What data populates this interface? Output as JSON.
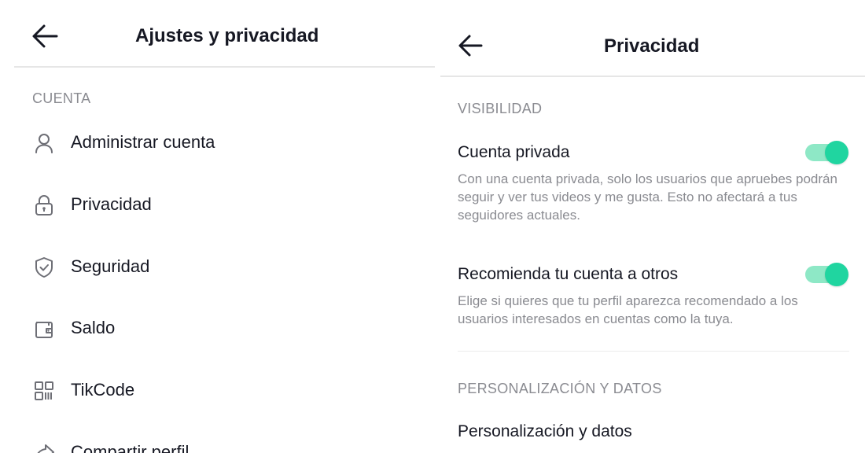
{
  "left_screen": {
    "title": "Ajustes y privacidad",
    "section_cuenta": "CUENTA",
    "items": [
      {
        "label": "Administrar cuenta",
        "icon": "person-icon"
      },
      {
        "label": "Privacidad",
        "icon": "lock-icon"
      },
      {
        "label": "Seguridad",
        "icon": "shield-check-icon"
      },
      {
        "label": "Saldo",
        "icon": "wallet-icon"
      },
      {
        "label": "TikCode",
        "icon": "qr-code-icon"
      },
      {
        "label": "Compartir perfil",
        "icon": "share-icon"
      }
    ]
  },
  "right_screen": {
    "title": "Privacidad",
    "section_visibilidad": "VISIBILIDAD",
    "private_account": {
      "title": "Cuenta privada",
      "description": "Con una cuenta privada, solo los usuarios que apruebes podrán seguir y ver tus videos y me gusta. Esto no afectará a tus seguidores actuales.",
      "enabled": true
    },
    "suggest_account": {
      "title": "Recomienda tu cuenta a otros",
      "description": "Elige si quieres que tu perfil aparezca recomendado a los usuarios interesados en cuentas como la tuya.",
      "enabled": true
    },
    "section_personalizacion": "PERSONALIZACIÓN Y DATOS",
    "personalizacion_item": "Personalización y datos"
  },
  "colors": {
    "toggle_on_track": "#8ee8c6",
    "toggle_on_knob": "#20d5a0",
    "secondary_text": "#8a8b91",
    "primary_text": "#161823"
  }
}
